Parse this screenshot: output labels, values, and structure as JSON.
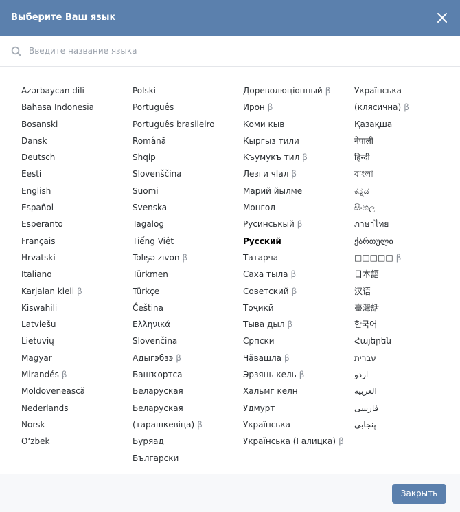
{
  "header": {
    "title": "Выберите Ваш язык"
  },
  "search": {
    "placeholder": "Введите название языка"
  },
  "languages": [
    [
      {
        "label": "Azərbaycan dili"
      },
      {
        "label": "Bahasa Indonesia"
      },
      {
        "label": "Bosanski"
      },
      {
        "label": "Dansk"
      },
      {
        "label": "Deutsch"
      },
      {
        "label": "Eesti"
      },
      {
        "label": "English"
      },
      {
        "label": "Español"
      },
      {
        "label": "Esperanto"
      },
      {
        "label": "Français"
      },
      {
        "label": "Hrvatski"
      },
      {
        "label": "Italiano"
      },
      {
        "label": "Karjalan kieli",
        "beta": "β"
      },
      {
        "label": "Kiswahili"
      },
      {
        "label": "Latviešu"
      },
      {
        "label": "Lietuvių"
      },
      {
        "label": "Magyar"
      },
      {
        "label": "Mirandés",
        "beta": "β"
      },
      {
        "label": "Moldovenească"
      },
      {
        "label": "Nederlands"
      },
      {
        "label": "Norsk"
      },
      {
        "label": "O‘zbek"
      }
    ],
    [
      {
        "label": "Polski"
      },
      {
        "label": "Português"
      },
      {
        "label": "Português brasileiro"
      },
      {
        "label": "Română"
      },
      {
        "label": "Shqip"
      },
      {
        "label": "Slovenščina"
      },
      {
        "label": "Suomi"
      },
      {
        "label": "Svenska"
      },
      {
        "label": "Tagalog"
      },
      {
        "label": "Tiếng Việt"
      },
      {
        "label": "Tolışə zıvon",
        "beta": "β"
      },
      {
        "label": "Türkmen"
      },
      {
        "label": "Türkçe"
      },
      {
        "label": "Čeština"
      },
      {
        "label": "Ελληνικά"
      },
      {
        "label": "Slovenčina"
      },
      {
        "label": "Адыгэбзэ",
        "beta": "β"
      },
      {
        "label": "Башҡортса"
      },
      {
        "label": "Беларуская"
      },
      {
        "label": "Беларуская (тарашкевіца)",
        "beta": "β",
        "wrap": true
      },
      {
        "label": "Буряад"
      },
      {
        "label": "Български"
      }
    ],
    [
      {
        "label": "Дореволюціонный",
        "beta": "β"
      },
      {
        "label": "Ирон",
        "beta": "β"
      },
      {
        "label": "Коми кыв"
      },
      {
        "label": "Кыргыз тили"
      },
      {
        "label": "Къумукъ тил",
        "beta": "β"
      },
      {
        "label": "Лезги чІал",
        "beta": "β"
      },
      {
        "label": "Марий йылме"
      },
      {
        "label": "Монгол"
      },
      {
        "label": "Русинськый",
        "beta": "β"
      },
      {
        "label": "Русский",
        "active": true
      },
      {
        "label": "Татарча"
      },
      {
        "label": "Саха тыла",
        "beta": "β"
      },
      {
        "label": "Советский",
        "beta": "β"
      },
      {
        "label": "Тоҷикӣ"
      },
      {
        "label": "Тыва дыл",
        "beta": "β"
      },
      {
        "label": "Српски"
      },
      {
        "label": "Чӑвашла",
        "beta": "β"
      },
      {
        "label": "Эрзянь кель",
        "beta": "β"
      },
      {
        "label": "Хальмг келн"
      },
      {
        "label": "Удмурт"
      },
      {
        "label": "Українська"
      },
      {
        "label": "Українська (Галицка)",
        "beta": "β"
      }
    ],
    [
      {
        "label": "Українська (клясична)",
        "beta": "β",
        "wrap": true
      },
      {
        "label": "Қазақша"
      },
      {
        "label": "नेपाली"
      },
      {
        "label": "हिन्दी"
      },
      {
        "label": "বাংলা"
      },
      {
        "label": "ಕನ್ನಡ"
      },
      {
        "label": "සිංහල"
      },
      {
        "label": "ภาษาไทย"
      },
      {
        "label": "ქართული"
      },
      {
        "label": "□□□□□",
        "beta": "β"
      },
      {
        "label": "日本語"
      },
      {
        "label": "汉语"
      },
      {
        "label": "臺灣話"
      },
      {
        "label": "한국어"
      },
      {
        "label": "Հայերեն"
      },
      {
        "label": "עברית"
      },
      {
        "label": "اردو"
      },
      {
        "label": "العربية"
      },
      {
        "label": "فارسی"
      },
      {
        "label": "پنجابی"
      }
    ]
  ],
  "footer": {
    "close_label": "Закрыть"
  },
  "colors": {
    "header_bg": "#5b80ad",
    "button_bg": "#5b80ad"
  },
  "icons": {
    "close": "close-icon",
    "search": "search-icon"
  }
}
